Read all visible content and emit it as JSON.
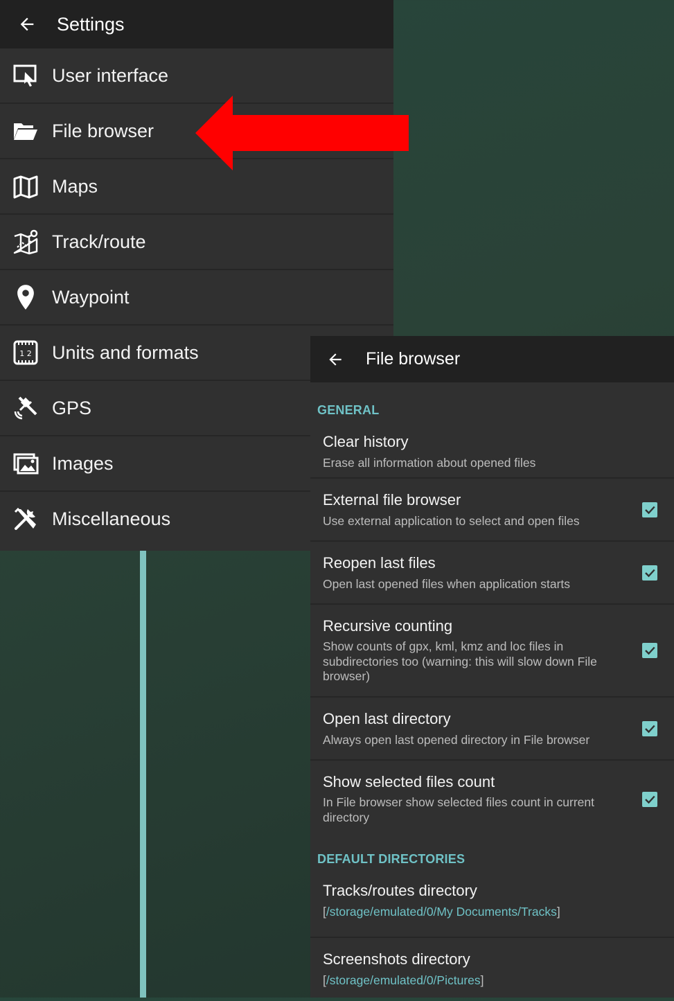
{
  "settings": {
    "title": "Settings",
    "items": [
      {
        "label": "User interface",
        "icon": "user-interface-icon"
      },
      {
        "label": "File browser",
        "icon": "folder-open-icon"
      },
      {
        "label": "Maps",
        "icon": "map-icon"
      },
      {
        "label": "Track/route",
        "icon": "track-route-icon"
      },
      {
        "label": "Waypoint",
        "icon": "waypoint-icon"
      },
      {
        "label": "Units and formats",
        "icon": "units-icon"
      },
      {
        "label": "GPS",
        "icon": "gps-satellite-icon"
      },
      {
        "label": "Images",
        "icon": "images-icon"
      },
      {
        "label": "Miscellaneous",
        "icon": "tools-icon"
      }
    ]
  },
  "file_browser": {
    "title": "File browser",
    "general_header": "GENERAL",
    "prefs": [
      {
        "title": "Clear history",
        "summary": "Erase all information about opened files",
        "checked": null
      },
      {
        "title": "External file browser",
        "summary": "Use external application to select and open files",
        "checked": true
      },
      {
        "title": "Reopen last files",
        "summary": "Open last opened files when application starts",
        "checked": true
      },
      {
        "title": "Recursive counting",
        "summary": "Show counts of gpx, kml, kmz and loc files in subdirectories too (warning: this will slow down File browser)",
        "checked": true
      },
      {
        "title": "Open last directory",
        "summary": "Always open last opened directory in File browser",
        "checked": true
      },
      {
        "title": "Show selected files count",
        "summary": "In File browser show selected files count in current directory",
        "checked": true
      }
    ],
    "dirs_header": "DEFAULT DIRECTORIES",
    "dirs": [
      {
        "title": "Tracks/routes directory",
        "path": "/storage/emulated/0/My Documents/Tracks"
      },
      {
        "title": "Screenshots directory",
        "path": "/storage/emulated/0/Pictures"
      }
    ]
  },
  "colors": {
    "accent": "#6fc2c6",
    "checkbox": "#7fd0cc",
    "panel": "#303030",
    "toolbar": "#212121",
    "arrow": "#ff0000"
  }
}
